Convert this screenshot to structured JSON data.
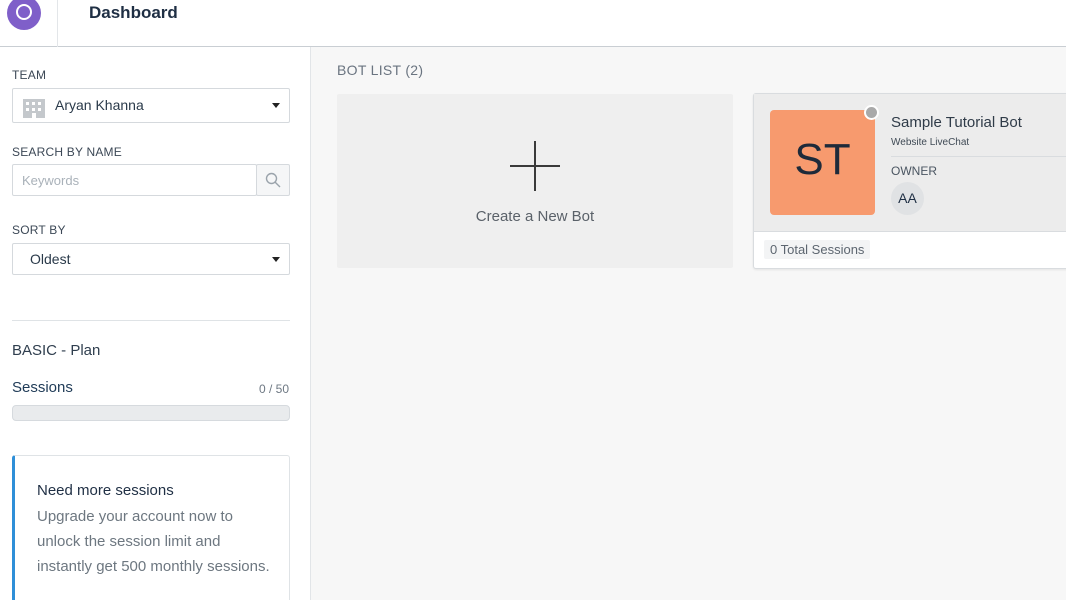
{
  "header": {
    "title": "Dashboard"
  },
  "sidebar": {
    "team": {
      "label": "TEAM",
      "value": "Aryan Khanna"
    },
    "search": {
      "label": "SEARCH BY NAME",
      "placeholder": "Keywords"
    },
    "sort": {
      "label": "SORT BY",
      "value": "Oldest"
    },
    "plan": {
      "name": "BASIC - Plan"
    },
    "sessions": {
      "label": "Sessions",
      "count": "0 / 50",
      "progress_fraction": 0
    },
    "upgrade": {
      "title": "Need more sessions",
      "text": "Upgrade your account now to unlock the session limit and instantly get 500 monthly sessions."
    }
  },
  "main": {
    "title": "BOT LIST (2)",
    "new_bot_label": "Create a New Bot",
    "bots": [
      {
        "initials": "ST",
        "name": "Sample Tutorial Bot",
        "type": "Website LiveChat",
        "owner_label": "OWNER",
        "owner_initials": "AA",
        "total_sessions": "0 Total Sessions"
      }
    ]
  },
  "colors": {
    "brand": "#7f5fc9",
    "accent": "#2f8fd8",
    "bot_avatar": "#f79a6e",
    "status_offline": "#a9a9a9"
  }
}
